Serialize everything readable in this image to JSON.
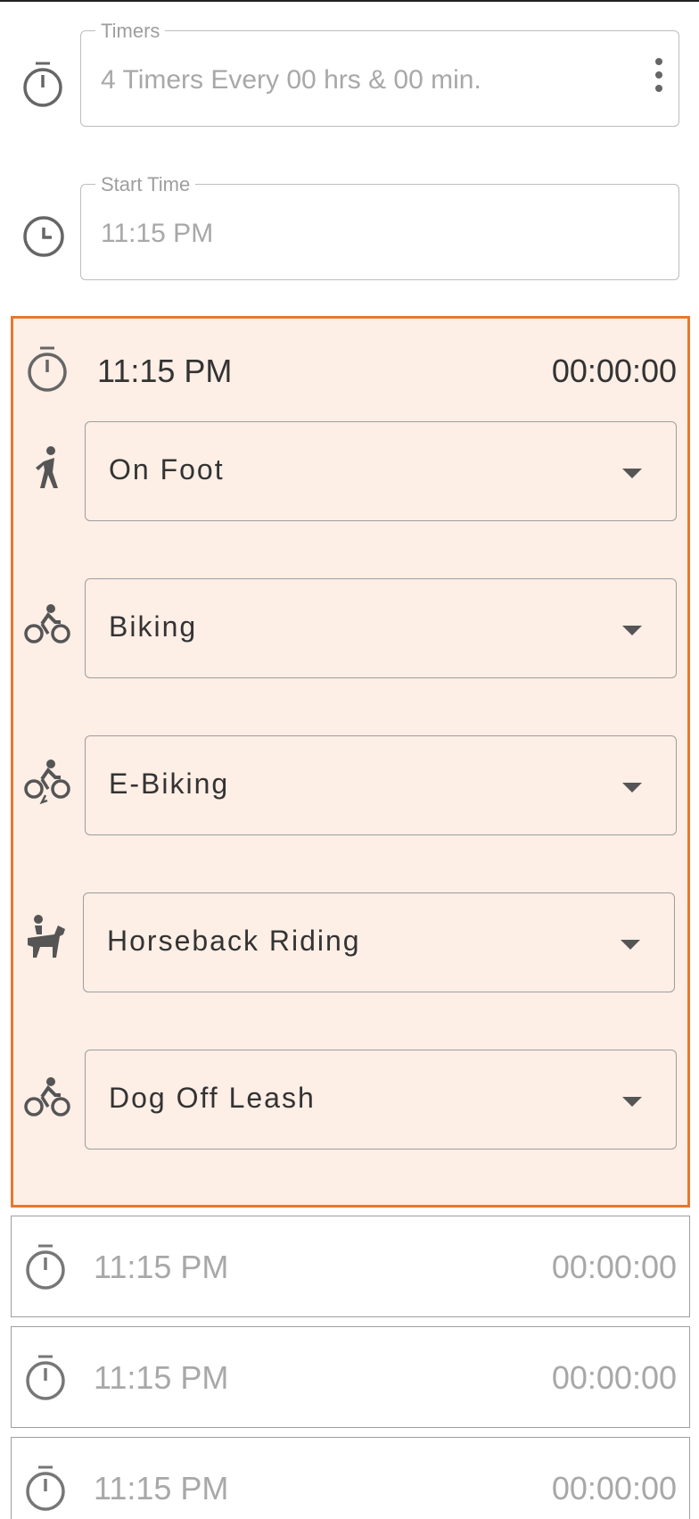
{
  "timers_field": {
    "label": "Timers",
    "value": "4 Timers Every 00 hrs & 00 min."
  },
  "start_time_field": {
    "label": "Start Time",
    "value": "11:15 PM"
  },
  "active_timer": {
    "time": "11:15 PM",
    "duration": "00:00:00",
    "activities": [
      {
        "label": "On Foot",
        "icon": "walking-icon"
      },
      {
        "label": "Biking",
        "icon": "bike-icon"
      },
      {
        "label": "E-Biking",
        "icon": "ebike-icon"
      },
      {
        "label": "Horseback Riding",
        "icon": "horse-icon"
      },
      {
        "label": "Dog Off Leash",
        "icon": "bike-icon"
      }
    ]
  },
  "timers": [
    {
      "time": "11:15 PM",
      "duration": "00:00:00"
    },
    {
      "time": "11:15 PM",
      "duration": "00:00:00"
    },
    {
      "time": "11:15 PM",
      "duration": "00:00:00"
    }
  ],
  "colors": {
    "accent": "#e8772e",
    "active_bg": "#fdeee6"
  }
}
